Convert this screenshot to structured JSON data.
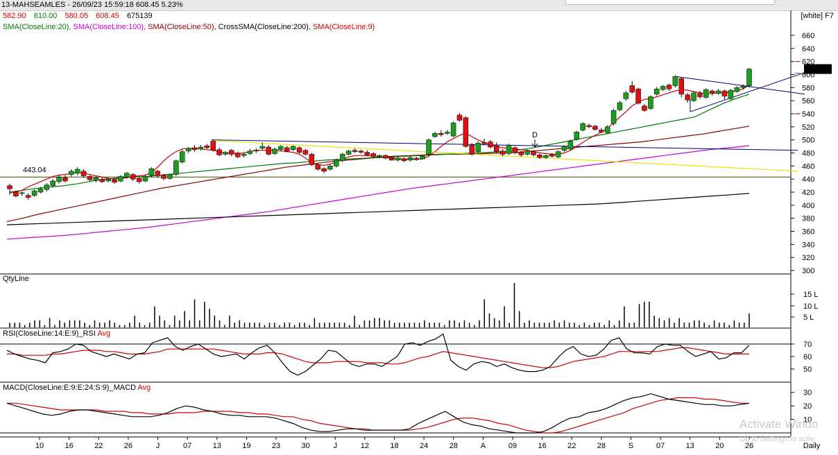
{
  "header": {
    "title": "13-MAHSEAMLES - 26/09/23 15:59:18 608.45 5.23%",
    "theme": "[white] F7"
  },
  "ohlc": [
    {
      "text": "582.90",
      "color": "#cc0000"
    },
    {
      "text": "610.00",
      "color": "#007700"
    },
    {
      "text": "580.05",
      "color": "#cc0000"
    },
    {
      "text": "608.45",
      "color": "#cc0000"
    },
    {
      "text": "675139",
      "color": "#000000"
    }
  ],
  "indicators": [
    {
      "label": "SMA(CloseLine:20),",
      "color": "#007700"
    },
    {
      "label": "SMA(CloseLine:100),",
      "color": "#cc00cc"
    },
    {
      "label": "SMA(CloseLine:50),",
      "color": "#880000"
    },
    {
      "label": "CrossSMA(CloseLine:200),",
      "color": "#000000"
    },
    {
      "label": "SMA(CloseLine:9)",
      "color": "#cc0000"
    }
  ],
  "panels": {
    "qty": "QtyLine",
    "rsi": "RSI(CloseLine:14:E:9)_RSI",
    "rsi_avg": "Avg",
    "macd": "MACD(CloseLine:E:9:E:24:S:9)_MACD",
    "macd_avg": "Avg"
  },
  "watermark": {
    "line1": "Activate Windo",
    "line2": "Go to Settings to activ"
  },
  "chart_data": {
    "type": "candlestick",
    "price_axis": {
      "ticks": [
        300,
        320,
        340,
        360,
        380,
        400,
        420,
        440,
        460,
        480,
        500,
        520,
        540,
        560,
        580,
        600,
        620,
        640,
        660
      ],
      "ylim": [
        290,
        670
      ]
    },
    "last_price_label": "608.45",
    "horizontal_level_label": "443.04",
    "horizontal_level": 443.04,
    "annotation": "D",
    "x_labels": [
      "10",
      "16",
      "22",
      "26",
      "J",
      "07",
      "13",
      "19",
      "23",
      "30",
      "J",
      "12",
      "18",
      "24",
      "28",
      "A",
      "09",
      "16",
      "22",
      "28",
      "S",
      "07",
      "13",
      "20",
      "26"
    ],
    "period_label": "Daily",
    "qty_axis": {
      "ticks": [
        "5 L",
        "10 L",
        "15 L"
      ]
    },
    "rsi_axis": {
      "ticks": [
        50,
        60,
        70
      ]
    },
    "macd_axis": {
      "ticks": [
        10,
        20,
        30
      ]
    },
    "candles": [
      [
        430,
        425,
        433,
        416
      ],
      [
        420,
        414,
        422,
        412
      ],
      [
        418,
        419,
        421,
        414
      ],
      [
        415,
        412,
        418,
        408
      ],
      [
        415,
        422,
        424,
        413
      ],
      [
        420,
        425,
        428,
        418
      ],
      [
        424,
        431,
        434,
        421
      ],
      [
        430,
        437,
        440,
        427
      ],
      [
        436,
        443,
        446,
        433
      ],
      [
        442,
        437,
        446,
        435
      ],
      [
        447,
        452,
        455,
        444
      ],
      [
        449,
        455,
        458,
        446
      ],
      [
        452,
        445,
        455,
        442
      ],
      [
        444,
        439,
        446,
        436
      ],
      [
        438,
        442,
        444,
        435
      ],
      [
        440,
        436,
        443,
        434
      ],
      [
        437,
        440,
        442,
        435
      ],
      [
        439,
        435,
        441,
        433
      ],
      [
        437,
        444,
        446,
        435
      ],
      [
        443,
        449,
        451,
        441
      ],
      [
        447,
        440,
        449,
        437
      ],
      [
        441,
        436,
        443,
        433
      ],
      [
        437,
        444,
        447,
        435
      ],
      [
        446,
        456,
        458,
        443
      ],
      [
        452,
        445,
        454,
        442
      ],
      [
        446,
        441,
        448,
        438
      ],
      [
        441,
        447,
        448,
        439
      ],
      [
        447,
        468,
        470,
        445
      ],
      [
        466,
        482,
        485,
        464
      ],
      [
        483,
        487,
        489,
        480
      ],
      [
        488,
        485,
        492,
        482
      ],
      [
        486,
        489,
        492,
        484
      ],
      [
        491,
        488,
        494,
        486
      ],
      [
        498,
        484,
        500,
        482
      ],
      [
        485,
        477,
        488,
        475
      ],
      [
        478,
        481,
        483,
        476
      ],
      [
        484,
        478,
        486,
        475
      ],
      [
        480,
        474,
        482,
        472
      ],
      [
        476,
        478,
        480,
        473
      ],
      [
        479,
        483,
        486,
        477
      ],
      [
        484,
        483,
        487,
        480
      ],
      [
        487,
        490,
        496,
        485
      ],
      [
        489,
        478,
        492,
        476
      ],
      [
        479,
        486,
        488,
        477
      ],
      [
        485,
        490,
        492,
        483
      ],
      [
        488,
        483,
        491,
        481
      ],
      [
        485,
        490,
        492,
        483
      ],
      [
        488,
        481,
        490,
        479
      ],
      [
        484,
        478,
        486,
        476
      ],
      [
        478,
        462,
        480,
        460
      ],
      [
        462,
        455,
        464,
        453
      ],
      [
        456,
        452,
        458,
        449
      ],
      [
        455,
        460,
        462,
        453
      ],
      [
        460,
        469,
        471,
        458
      ],
      [
        468,
        478,
        480,
        466
      ],
      [
        478,
        483,
        485,
        476
      ],
      [
        484,
        482,
        487,
        480
      ],
      [
        483,
        481,
        485,
        479
      ],
      [
        481,
        477,
        484,
        475
      ],
      [
        479,
        474,
        481,
        472
      ],
      [
        474,
        476,
        478,
        472
      ],
      [
        476,
        472,
        478,
        470
      ],
      [
        473,
        469,
        475,
        468
      ],
      [
        469,
        472,
        474,
        467
      ],
      [
        471,
        468,
        473,
        466
      ],
      [
        469,
        473,
        475,
        467
      ],
      [
        472,
        470,
        474,
        468
      ],
      [
        471,
        475,
        477,
        470
      ],
      [
        478,
        500,
        502,
        476
      ],
      [
        505,
        510,
        512,
        503
      ],
      [
        510,
        508,
        515,
        505
      ],
      [
        510,
        512,
        515,
        508
      ],
      [
        506,
        526,
        528,
        504
      ],
      [
        538,
        530,
        541,
        528
      ],
      [
        534,
        490,
        536,
        488
      ],
      [
        492,
        478,
        495,
        476
      ],
      [
        482,
        495,
        498,
        480
      ],
      [
        496,
        494,
        502,
        492
      ],
      [
        497,
        489,
        500,
        487
      ],
      [
        491,
        482,
        496,
        480
      ],
      [
        483,
        478,
        486,
        475
      ],
      [
        479,
        492,
        494,
        477
      ],
      [
        488,
        480,
        490,
        478
      ],
      [
        481,
        477,
        483,
        474
      ],
      [
        478,
        483,
        485,
        476
      ],
      [
        482,
        477,
        484,
        475
      ],
      [
        477,
        473,
        479,
        471
      ],
      [
        473,
        476,
        478,
        471
      ],
      [
        478,
        475,
        480,
        473
      ],
      [
        474,
        482,
        484,
        472
      ],
      [
        484,
        490,
        492,
        482
      ],
      [
        486,
        498,
        500,
        484
      ],
      [
        501,
        512,
        514,
        499
      ],
      [
        515,
        525,
        527,
        513
      ],
      [
        522,
        520,
        525,
        518
      ],
      [
        521,
        516,
        523,
        514
      ],
      [
        515,
        512,
        518,
        510
      ],
      [
        511,
        520,
        522,
        509
      ],
      [
        525,
        545,
        548,
        522
      ],
      [
        546,
        557,
        560,
        544
      ],
      [
        563,
        572,
        575,
        560
      ],
      [
        583,
        573,
        590,
        571
      ],
      [
        578,
        556,
        580,
        554
      ],
      [
        552,
        545,
        555,
        543
      ],
      [
        548,
        566,
        568,
        546
      ],
      [
        570,
        578,
        581,
        568
      ],
      [
        577,
        582,
        584,
        575
      ],
      [
        584,
        578,
        586,
        575
      ],
      [
        583,
        597,
        599,
        580
      ],
      [
        594,
        570,
        596,
        565
      ],
      [
        569,
        561,
        572,
        557
      ],
      [
        560,
        572,
        574,
        558
      ],
      [
        571,
        566,
        575,
        563
      ],
      [
        565,
        577,
        579,
        563
      ],
      [
        575,
        572,
        577,
        568
      ],
      [
        571,
        575,
        578,
        569
      ],
      [
        575,
        567,
        577,
        562
      ],
      [
        563,
        576,
        578,
        561
      ],
      [
        574,
        580,
        582,
        572
      ],
      [
        580,
        582,
        585,
        577
      ],
      [
        582.9,
        608.45,
        610,
        580.05
      ]
    ],
    "sma20": [
      420,
      423,
      426,
      428,
      430,
      433,
      437,
      440,
      442,
      443,
      444,
      446,
      448,
      450,
      452,
      454,
      456,
      458,
      460,
      462,
      464,
      465,
      467,
      469,
      470,
      471,
      472,
      473,
      474,
      475,
      476,
      477,
      478,
      479,
      480,
      481,
      482,
      484,
      487,
      491,
      495,
      499,
      503,
      507,
      511,
      515,
      519,
      523,
      527,
      531,
      535,
      545,
      555,
      563,
      570
    ],
    "sma50": [
      375,
      380,
      386,
      391,
      396,
      401,
      406,
      411,
      416,
      421,
      426,
      430,
      434,
      438,
      442,
      446,
      450,
      454,
      458,
      461,
      464,
      467,
      469,
      471,
      473,
      475,
      476,
      477,
      478,
      478,
      478,
      479,
      480,
      481,
      483,
      485,
      487,
      489,
      491,
      493,
      495,
      497,
      500,
      503,
      506,
      509,
      513,
      517,
      521
    ],
    "sma100": [
      348,
      350,
      352,
      354,
      357,
      360,
      363,
      366,
      370,
      374,
      378,
      382,
      386,
      390,
      395,
      400,
      405,
      410,
      415,
      420,
      425,
      429,
      433,
      437,
      441,
      445,
      449,
      453,
      457,
      461,
      465,
      469,
      473,
      477,
      481,
      485,
      488,
      491
    ],
    "sma200": [
      370,
      371,
      372,
      373,
      374,
      375,
      376,
      377,
      378,
      379,
      380,
      381,
      382,
      383,
      384,
      385,
      386,
      387,
      388,
      389,
      390,
      391,
      392,
      393,
      394,
      395,
      396,
      397,
      398,
      399,
      400,
      401,
      402,
      404,
      406,
      408,
      410,
      412,
      414,
      416,
      418
    ],
    "sma9": [
      419,
      420,
      423,
      428,
      432,
      436,
      440,
      444,
      446,
      447,
      449,
      450,
      449,
      447,
      445,
      443,
      441,
      440,
      441,
      442,
      444,
      445,
      446,
      450,
      458,
      468,
      476,
      482,
      486,
      487,
      487,
      486,
      485,
      484,
      482,
      480,
      479,
      479,
      480,
      482,
      484,
      484,
      484,
      484,
      483,
      482,
      481,
      478,
      472,
      466,
      462,
      461,
      463,
      466,
      470,
      474,
      476,
      476,
      476,
      475,
      474,
      473,
      472,
      471,
      471,
      470,
      470,
      471,
      475,
      482,
      490,
      497,
      502,
      507,
      510,
      505,
      500,
      496,
      493,
      490,
      488,
      487,
      486,
      485,
      484,
      482,
      480,
      479,
      478,
      478,
      480,
      484,
      490,
      496,
      502,
      507,
      512,
      518,
      526,
      535,
      543,
      552,
      558,
      562,
      563,
      566,
      569,
      572,
      575,
      577,
      576,
      574,
      572,
      571,
      571,
      572,
      572,
      573,
      575,
      578,
      584
    ],
    "volume": [
      2,
      2,
      2,
      1,
      2,
      3,
      3,
      1,
      4,
      1,
      3,
      2,
      3,
      3,
      3,
      2,
      1,
      3,
      2,
      2,
      3,
      2,
      1,
      1,
      2,
      5,
      2,
      1,
      2,
      9,
      5,
      3,
      1,
      5,
      3,
      7,
      3,
      12,
      3,
      11,
      8,
      5,
      3,
      1,
      5,
      2,
      3,
      2,
      2,
      2,
      2,
      1,
      2,
      2,
      1,
      2,
      2,
      1,
      2,
      2,
      1,
      4,
      2,
      2,
      2,
      2,
      2,
      2,
      1,
      5,
      1,
      3,
      3,
      4,
      4,
      3,
      3,
      2,
      2,
      2,
      2,
      2,
      2,
      3,
      2,
      2,
      2,
      1,
      3,
      3,
      2,
      3,
      2,
      1,
      3,
      12,
      6,
      4,
      3,
      9,
      2,
      19,
      7,
      2,
      3,
      2,
      2,
      2,
      2,
      3,
      2,
      3,
      2,
      2,
      1,
      2,
      1,
      2,
      2,
      1,
      3,
      1,
      3,
      9,
      2,
      2,
      10,
      11,
      11,
      5,
      4,
      3,
      4,
      2,
      4,
      2,
      2,
      3,
      3,
      2,
      1,
      3,
      2,
      2,
      1,
      3,
      2,
      2,
      6
    ],
    "rsi": [
      65,
      62,
      60,
      58,
      57,
      55,
      63,
      64,
      66,
      70,
      69,
      64,
      62,
      60,
      62,
      60,
      58,
      62,
      63,
      71,
      73,
      75,
      68,
      65,
      68,
      70,
      66,
      62,
      60,
      61,
      62,
      58,
      63,
      67,
      69,
      63,
      55,
      48,
      45,
      48,
      53,
      58,
      65,
      64,
      59,
      54,
      52,
      54,
      54,
      52,
      56,
      60,
      70,
      71,
      69,
      72,
      74,
      78,
      57,
      52,
      49,
      54,
      56,
      55,
      52,
      54,
      51,
      49,
      48,
      48,
      49,
      52,
      59,
      65,
      68,
      62,
      60,
      61,
      66,
      73,
      75,
      66,
      63,
      63,
      62,
      68,
      70,
      69,
      69,
      64,
      60,
      62,
      64,
      58,
      59,
      63,
      63,
      69
    ],
    "rsi_avg": [
      62,
      62,
      61,
      61,
      61,
      61,
      62,
      62,
      63,
      64,
      65,
      65,
      65,
      64,
      64,
      63,
      62,
      62,
      62,
      63,
      64,
      66,
      66,
      66,
      66,
      66,
      66,
      66,
      65,
      64,
      63,
      62,
      62,
      62,
      63,
      63,
      62,
      60,
      58,
      56,
      55,
      55,
      55,
      56,
      56,
      56,
      56,
      55,
      55,
      55,
      54,
      54,
      55,
      57,
      59,
      60,
      62,
      64,
      63,
      62,
      61,
      60,
      59,
      58,
      57,
      56,
      55,
      54,
      53,
      52,
      51,
      51,
      52,
      54,
      56,
      57,
      58,
      59,
      60,
      62,
      64,
      64,
      64,
      64,
      64,
      64,
      65,
      66,
      67,
      67,
      66,
      65,
      64,
      63,
      62,
      62,
      62,
      62
    ],
    "macd": [
      22,
      20,
      18,
      16,
      14,
      13,
      14,
      16,
      17,
      17,
      16,
      15,
      14,
      13,
      12,
      12,
      12,
      13,
      15,
      18,
      20,
      19,
      17,
      16,
      14,
      13,
      13,
      12,
      12,
      12,
      11,
      9,
      7,
      4,
      2,
      1,
      1,
      2,
      3,
      3,
      2,
      2,
      2,
      2,
      2,
      3,
      7,
      10,
      13,
      16,
      12,
      8,
      6,
      5,
      3,
      2,
      1,
      0,
      0,
      0,
      1,
      4,
      8,
      11,
      12,
      15,
      16,
      18,
      21,
      24,
      26,
      27,
      29,
      27,
      25,
      24,
      23,
      22,
      21,
      21,
      20,
      20,
      21,
      22
    ],
    "macd_avg": [
      22,
      22,
      21,
      20,
      19,
      18,
      17,
      17,
      17,
      17,
      17,
      16,
      16,
      16,
      15,
      15,
      14,
      14,
      14,
      15,
      15,
      15,
      16,
      16,
      16,
      16,
      15,
      15,
      14,
      14,
      13,
      12,
      12,
      10,
      9,
      7,
      6,
      5,
      4,
      3,
      3,
      2,
      2,
      2,
      2,
      2,
      3,
      4,
      6,
      8,
      10,
      11,
      11,
      10,
      9,
      7,
      6,
      4,
      2,
      1,
      0,
      0,
      1,
      3,
      5,
      7,
      9,
      11,
      13,
      15,
      18,
      20,
      22,
      24,
      25,
      26,
      26,
      26,
      25,
      25,
      24,
      23,
      22,
      22
    ]
  }
}
